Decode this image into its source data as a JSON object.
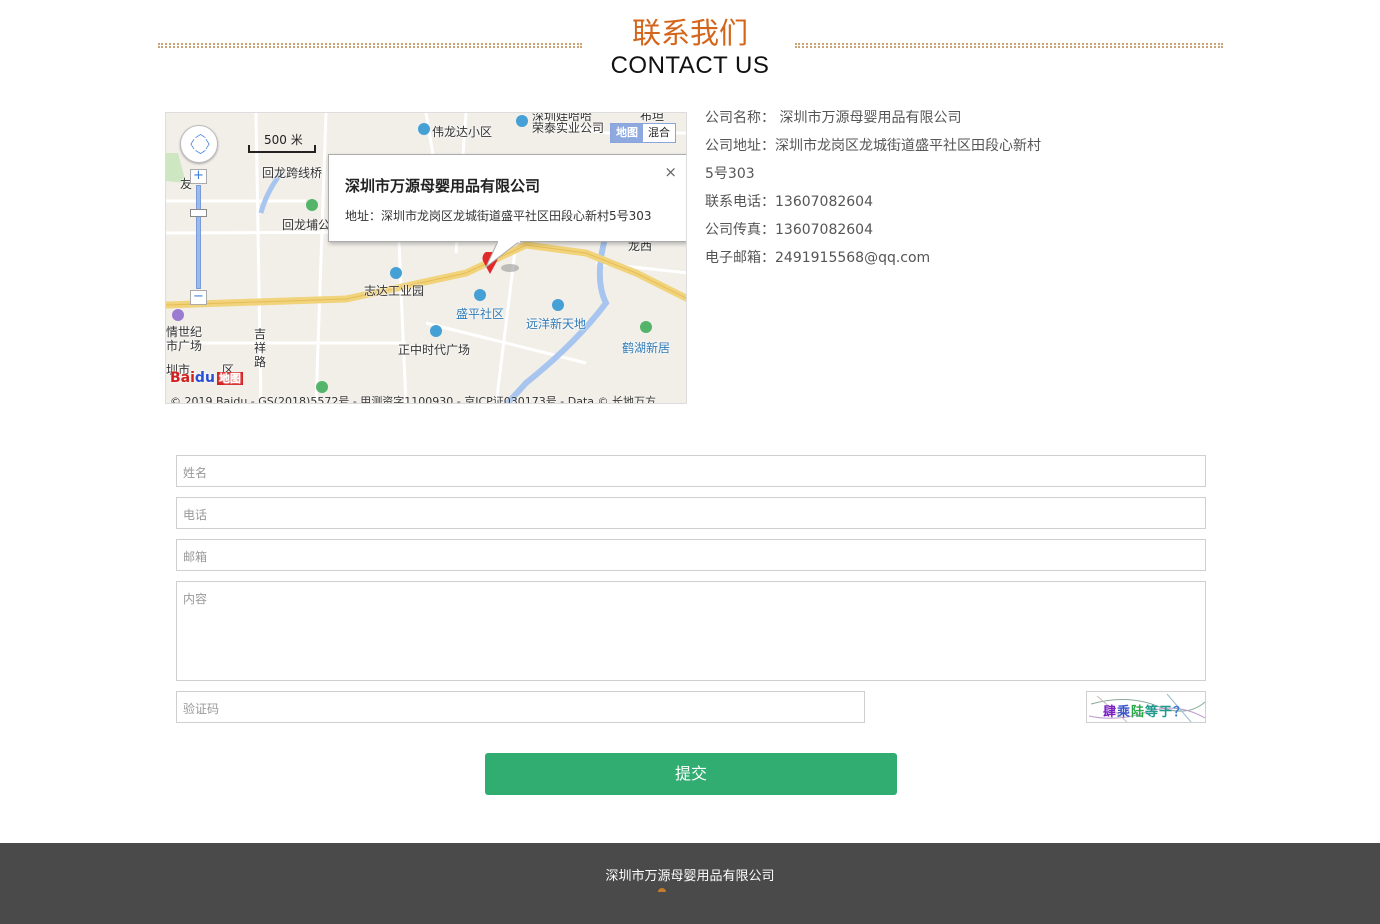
{
  "header": {
    "title_cn": "联系我们",
    "title_en": "CONTACT US"
  },
  "map": {
    "scale": "500 米",
    "type_map": "地图",
    "type_hybrid": "混合",
    "zoom_in": "+",
    "zoom_out": "−",
    "info_title": "深圳市万源母婴用品有限公司",
    "info_address": "地址：深圳市龙岗区龙城街道盛平社区田段心新村5号303",
    "close": "×",
    "labels": [
      "深圳娃哈哈",
      "伟龙达小区",
      "荣泰实业公司",
      "回龙跨线桥",
      "友",
      "回龙埔公",
      "龙西",
      "志达工业园",
      "盛平社区",
      "远洋新天地",
      "情世纪",
      "市广场",
      "吉",
      "祥",
      "路",
      "正中时代广场",
      "鹤湖新居",
      "圳市",
      "区",
      "布坦"
    ],
    "baidu_logo": [
      "Bai",
      "du",
      "地图"
    ],
    "copyright": "© 2019 Baidu - GS(2018)5572号 - 甲测资字1100930 - 京ICP证030173号 - Data © 长地万方"
  },
  "company": {
    "name_label": "公司名称：",
    "name": "深圳市万源母婴用品有限公司",
    "address_label": "公司地址：",
    "address_line1": "深圳市龙岗区龙城街道盛平社区田段心新村",
    "address_line2": "5号303",
    "phone_label": "联系电话：",
    "phone": "13607082604",
    "fax_label": "公司传真：",
    "fax": "13607082604",
    "email_label": "电子邮箱：",
    "email": "2491915568@qq.com"
  },
  "form": {
    "name_placeholder": "姓名",
    "phone_placeholder": "电话",
    "email_placeholder": "邮箱",
    "content_placeholder": "内容",
    "captcha_placeholder": "验证码",
    "captcha_text": [
      "肆",
      "乘",
      "陆",
      "等于",
      "？"
    ],
    "submit_label": "提交"
  },
  "footer": {
    "company_name": "深圳市万源母婴用品有限公司"
  },
  "colors": {
    "accent_orange": "#d4661c",
    "submit_green": "#31ad72",
    "footer_bg": "#4a4a4a"
  }
}
